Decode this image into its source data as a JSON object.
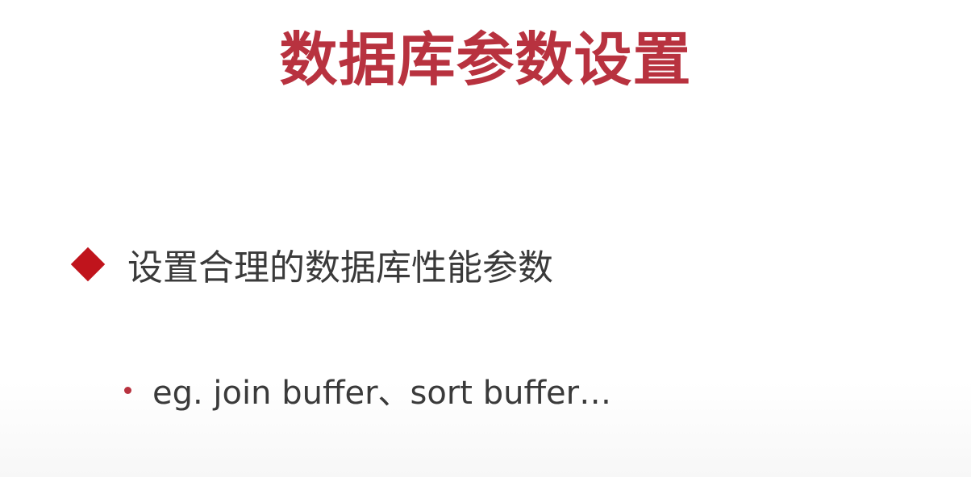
{
  "slide": {
    "title": "数据库参数设置",
    "bullets": [
      {
        "icon": "diamond-icon",
        "text": "设置合理的数据库性能参数",
        "sub_items": [
          {
            "icon": "dot-icon",
            "text": "eg. join buffer、sort buffer…"
          }
        ]
      }
    ],
    "colors": {
      "title": "#b8323f",
      "bullet_marker": "#c0141c",
      "body_text": "#3a3a3a",
      "background": "#ffffff"
    }
  }
}
